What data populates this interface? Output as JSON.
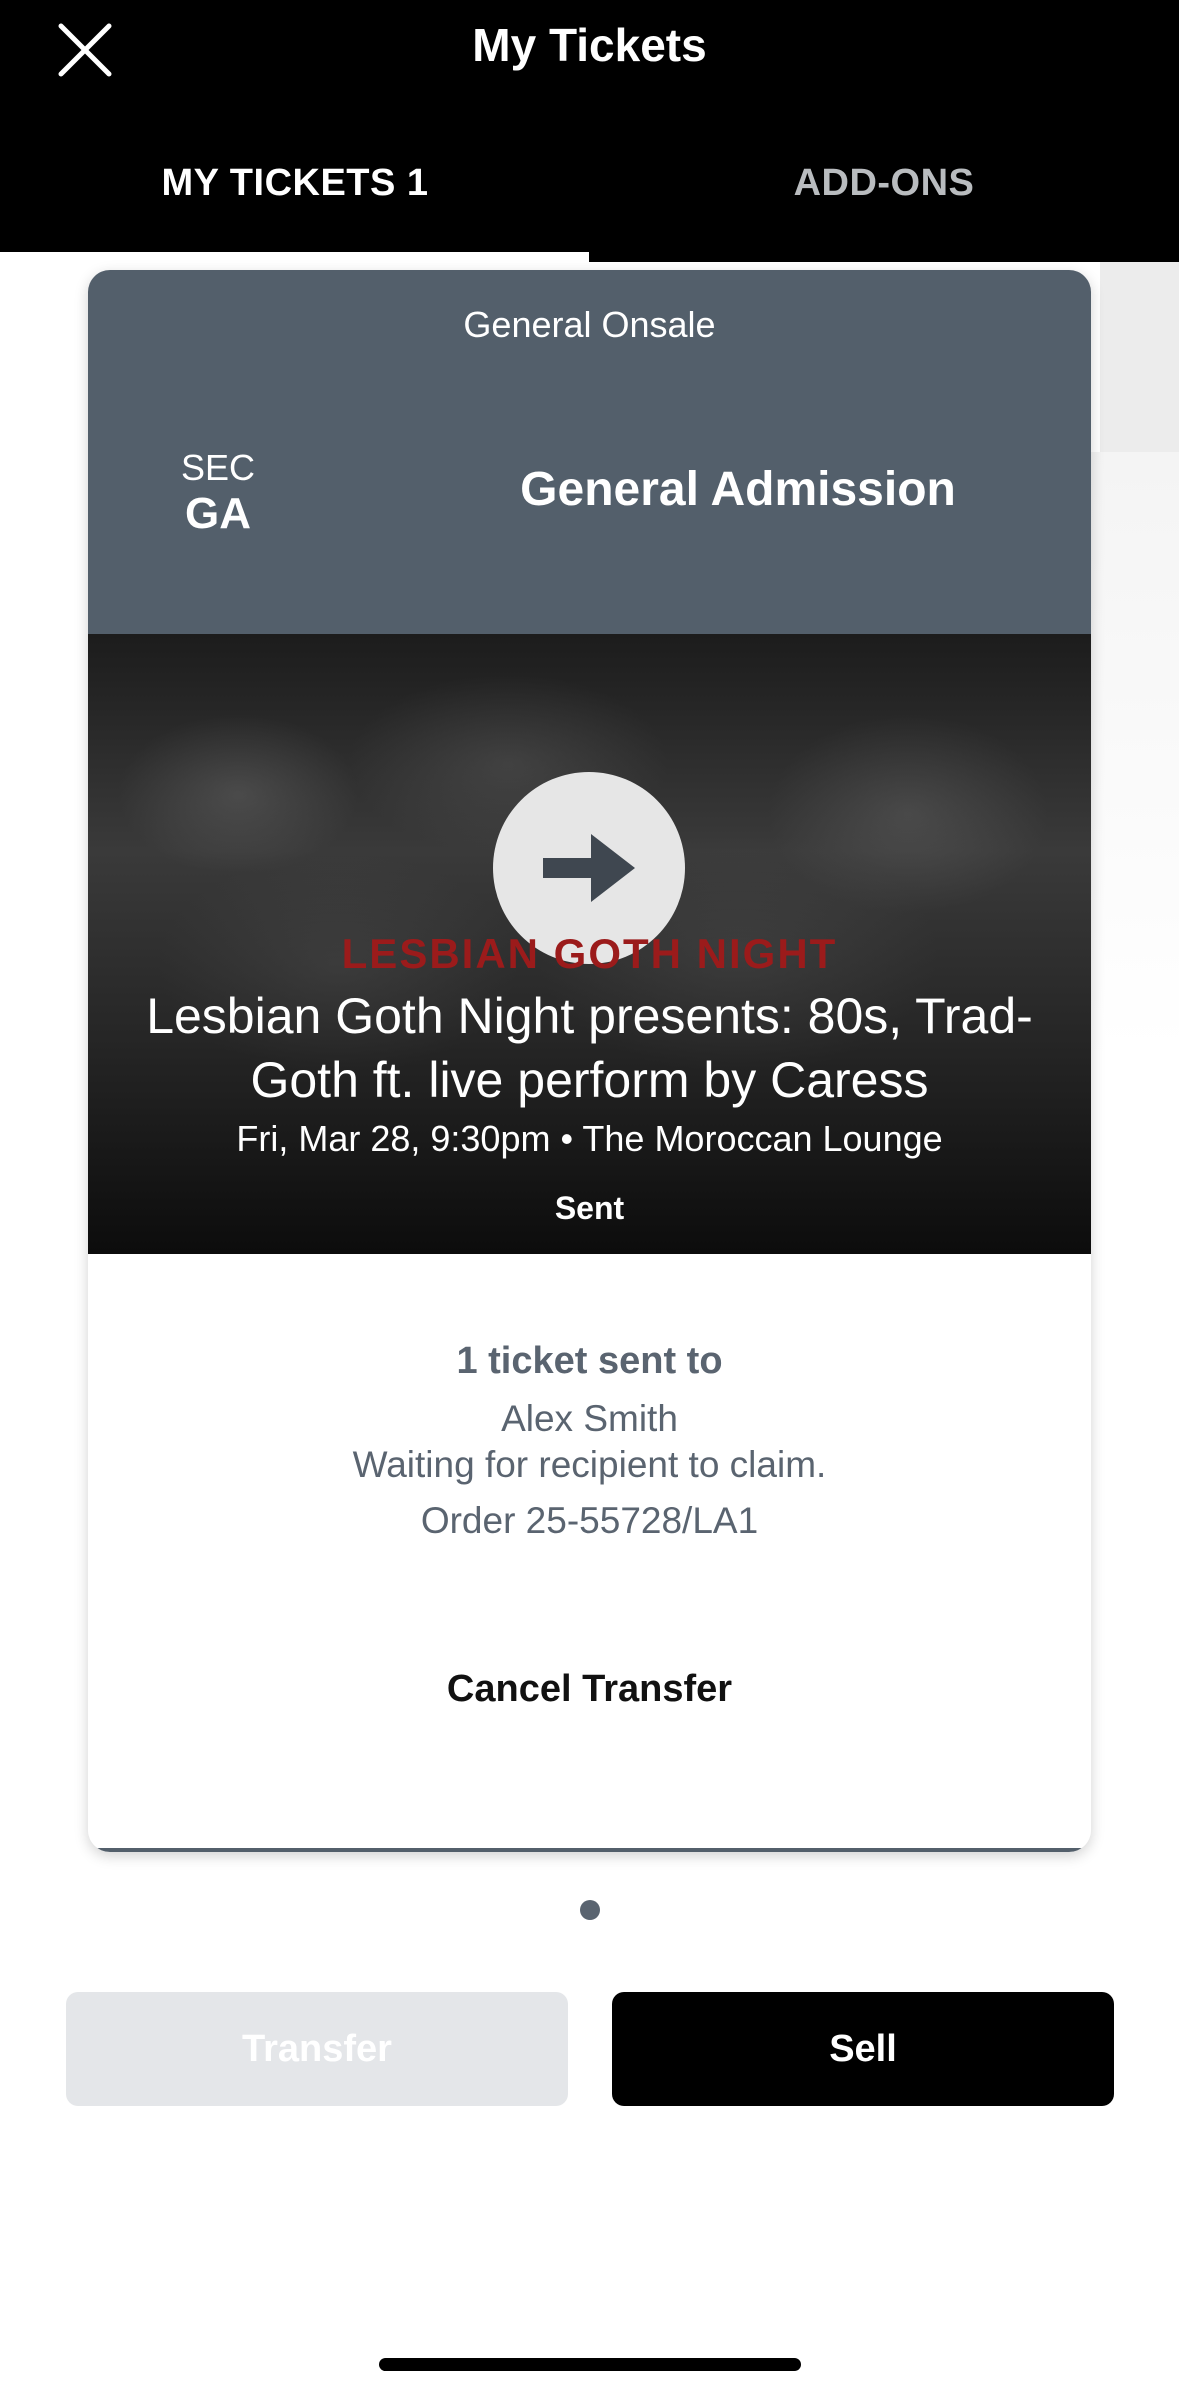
{
  "header": {
    "title": "My Tickets",
    "close_icon": "close-icon"
  },
  "tabs": [
    {
      "label": "MY TICKETS 1",
      "active": true
    },
    {
      "label": "ADD-ONS",
      "active": false
    }
  ],
  "ticket": {
    "onsale_label": "General Onsale",
    "section_label": "SEC",
    "section_value": "GA",
    "admission_type": "General Admission",
    "poster_text": "LESBIAN GOTH NIGHT",
    "event_title": "Lesbian Goth Night presents: 80s, Trad-Goth ft. live perform by Caress",
    "event_meta": "Fri, Mar 28, 9:30pm • The Moroccan Lounge",
    "status": "Sent",
    "sent_count": "1 ticket sent to",
    "recipient": "Alex Smith",
    "waiting_text": "Waiting for recipient to claim.",
    "order": "Order 25-55728/LA1",
    "cancel_label": "Cancel Transfer",
    "play_icon": "arrow-right-icon"
  },
  "pagination": {
    "current": 1,
    "total": 1
  },
  "actions": {
    "transfer_label": "Transfer",
    "sell_label": "Sell"
  },
  "colors": {
    "header_bg": "#000000",
    "card_header_bg": "#535f6b",
    "body_text": "#5a6470",
    "transfer_disabled_bg": "#e4e6e9",
    "sell_bg": "#000000",
    "poster_accent": "#9b1b1b"
  }
}
